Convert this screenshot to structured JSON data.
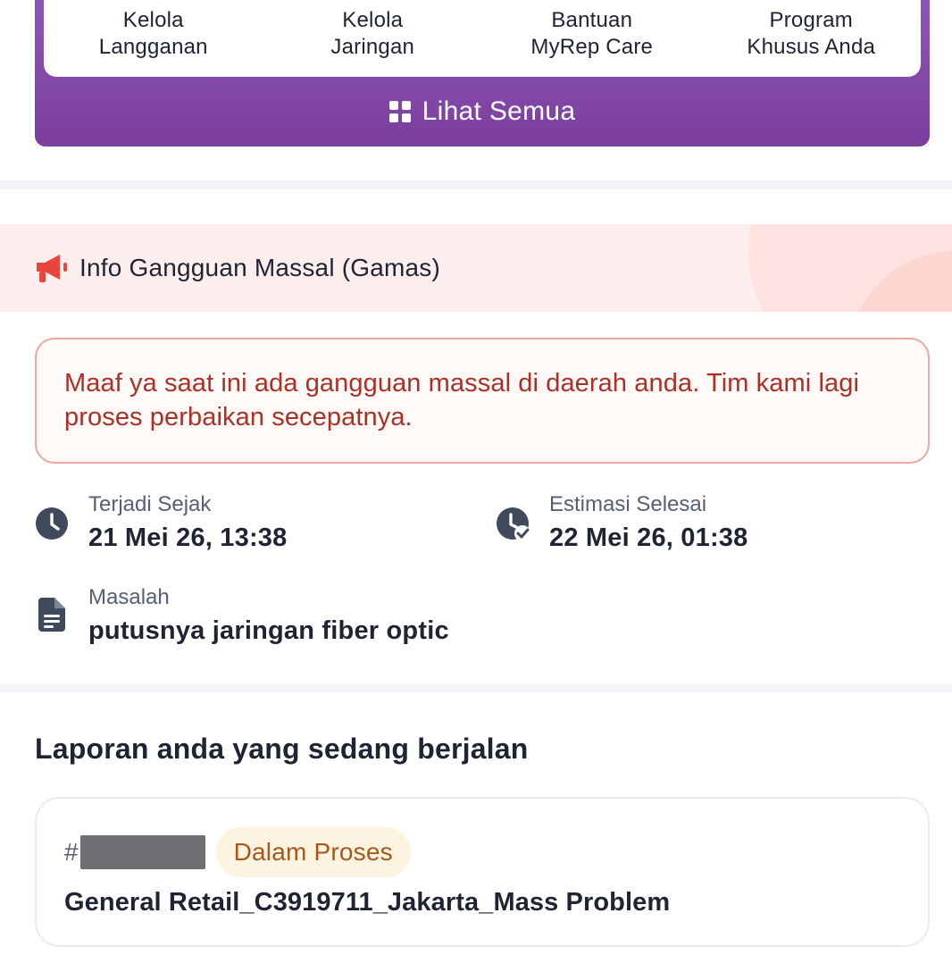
{
  "menu": {
    "items": [
      {
        "line1": "Kelola",
        "line2": "Langganan"
      },
      {
        "line1": "Kelola",
        "line2": "Jaringan"
      },
      {
        "line1": "Bantuan",
        "line2": "MyRep Care"
      },
      {
        "line1": "Program",
        "line2": "Khusus Anda"
      }
    ],
    "see_all_label": "Lihat Semua"
  },
  "gamas": {
    "title": "Info Gangguan Massal (Gamas)",
    "message": "Maaf ya saat ini ada gangguan massal di daerah anda. Tim kami lagi proses perbaikan secepatnya.",
    "since_label": "Terjadi Sejak",
    "since_value": "21 Mei 26, 13:38",
    "estimate_label": "Estimasi Selesai",
    "estimate_value": "22 Mei 26, 01:38",
    "problem_label": "Masalah",
    "problem_value": "putusnya jaringan fiber optic"
  },
  "reports": {
    "section_title": "Laporan anda yang sedang berjalan",
    "items": [
      {
        "hash": "#",
        "status": "Dalam Proses",
        "title": "General Retail_C3919711_Jakarta_Mass Problem"
      }
    ]
  },
  "colors": {
    "brand_purple": "#8d55b6",
    "alert_red": "#ad3026",
    "status_orange": "#a9571b"
  },
  "icons": [
    "grid-icon",
    "megaphone-icon",
    "clock-icon",
    "clock-check-icon",
    "document-icon"
  ]
}
